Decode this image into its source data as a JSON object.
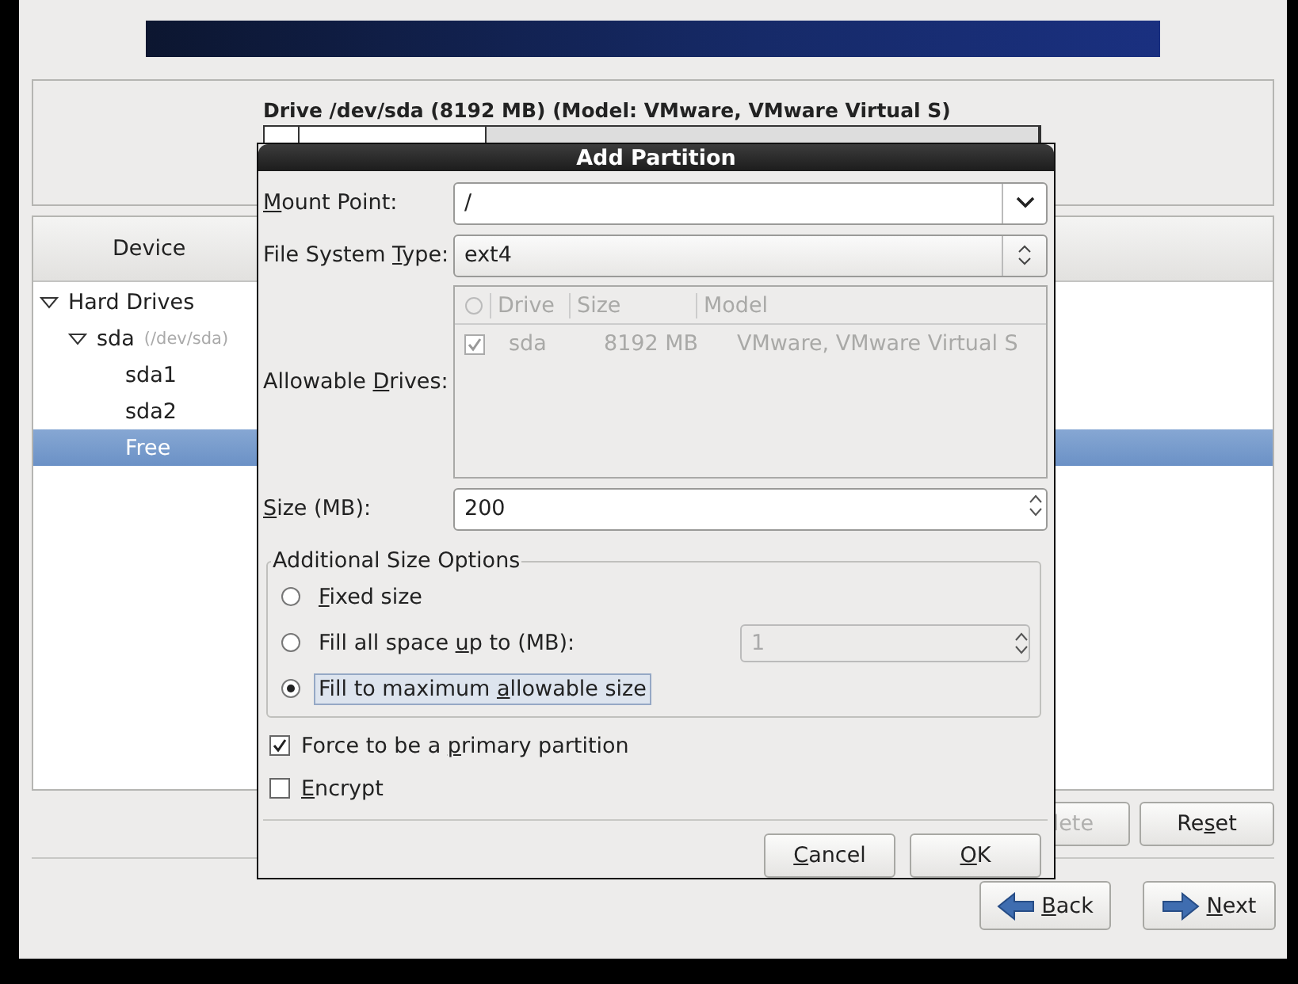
{
  "drive": {
    "title": "Drive /dev/sda (8192 MB) (Model: VMware, VMware Virtual S)"
  },
  "device_tree": {
    "column": "Device",
    "items": [
      {
        "label": "Hard Drives",
        "expanded": true,
        "selected": false,
        "children": [
          {
            "label": "sda",
            "hint": "(/dev/sda)",
            "expanded": true,
            "selected": false,
            "children": [
              {
                "label": "sda1",
                "selected": false
              },
              {
                "label": "sda2",
                "selected": false
              },
              {
                "label": "Free",
                "selected": true
              }
            ]
          }
        ]
      }
    ]
  },
  "panel_buttons": [
    {
      "label": {
        "after": "lete"
      },
      "disabled": true
    },
    {
      "label": {
        "before": "Re",
        "key": "s",
        "after": "et"
      },
      "disabled": false
    }
  ],
  "nav_buttons": [
    {
      "label": {
        "key": "B",
        "after": "ack"
      },
      "kind": "back"
    },
    {
      "label": {
        "key": "N",
        "after": "ext"
      },
      "kind": "next"
    }
  ],
  "dialog": {
    "title": "Add Partition",
    "mount_point": {
      "label": {
        "key": "M",
        "after": "ount Point:"
      },
      "value": "/"
    },
    "fs_type": {
      "label": {
        "before": "File System ",
        "key": "T",
        "after": "ype:"
      },
      "value": "ext4"
    },
    "drives": {
      "label": {
        "before": "Allowable ",
        "key": "D",
        "after": "rives:"
      },
      "columns": [
        "Drive",
        "Size",
        "Model"
      ],
      "rows": [
        {
          "checked": true,
          "drive": "sda",
          "size": "8192 MB",
          "model": "VMware, VMware Virtual S"
        }
      ]
    },
    "size": {
      "label": {
        "key": "S",
        "after": "ize (MB):"
      },
      "value": "200"
    },
    "size_options": {
      "title": "Additional Size Options",
      "options": [
        {
          "label": {
            "key": "F",
            "after": "ixed size"
          },
          "selected": false
        },
        {
          "label": {
            "before": "Fill all space ",
            "key": "u",
            "after": "p to (MB):"
          },
          "selected": false,
          "value": "1"
        },
        {
          "label": {
            "before": "Fill to maximum ",
            "key": "a",
            "after": "llowable size"
          },
          "selected": true
        }
      ]
    },
    "checks": [
      {
        "label": {
          "before": "Force to be a ",
          "key": "p",
          "after": "rimary partition"
        },
        "checked": true
      },
      {
        "label": {
          "key": "E",
          "after": "ncrypt"
        },
        "checked": false
      }
    ],
    "buttons": [
      {
        "label": {
          "key": "C",
          "after": "ancel"
        }
      },
      {
        "label": {
          "key": "O",
          "after": "K"
        }
      }
    ]
  }
}
